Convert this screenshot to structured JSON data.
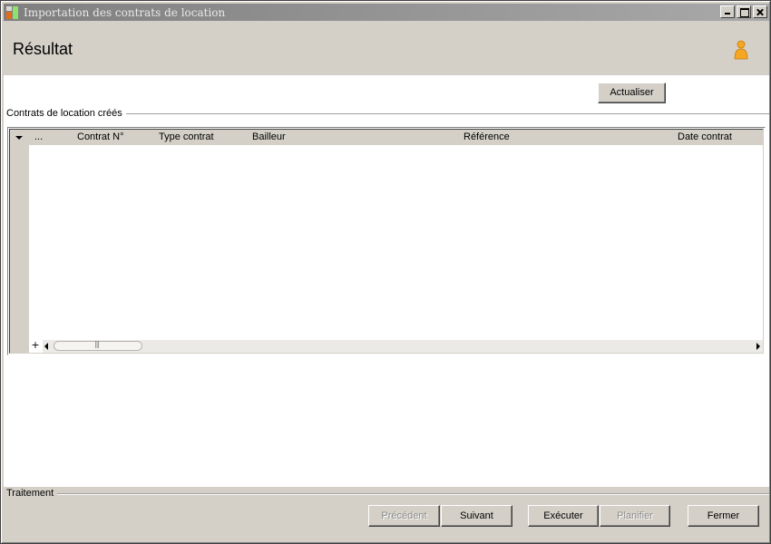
{
  "window": {
    "title": "Importation des contrats de location"
  },
  "header": {
    "title": "Résultat",
    "user_icon": "person-icon"
  },
  "toolbar": {
    "refresh_label": "Actualiser"
  },
  "contracts_group": {
    "label": "Contrats de location créés",
    "columns": [
      "...",
      "Contrat N°",
      "Type contrat",
      "Bailleur",
      "Référence",
      "Date contrat"
    ],
    "rows": []
  },
  "processing": {
    "label": "Traitement"
  },
  "buttons": {
    "previous": "Précédent",
    "next": "Suivant",
    "execute": "Exécuter",
    "schedule": "Planifier",
    "close": "Fermer"
  },
  "colors": {
    "titlebar": "#7f7f7f",
    "accent_icon": "#f5a623"
  }
}
